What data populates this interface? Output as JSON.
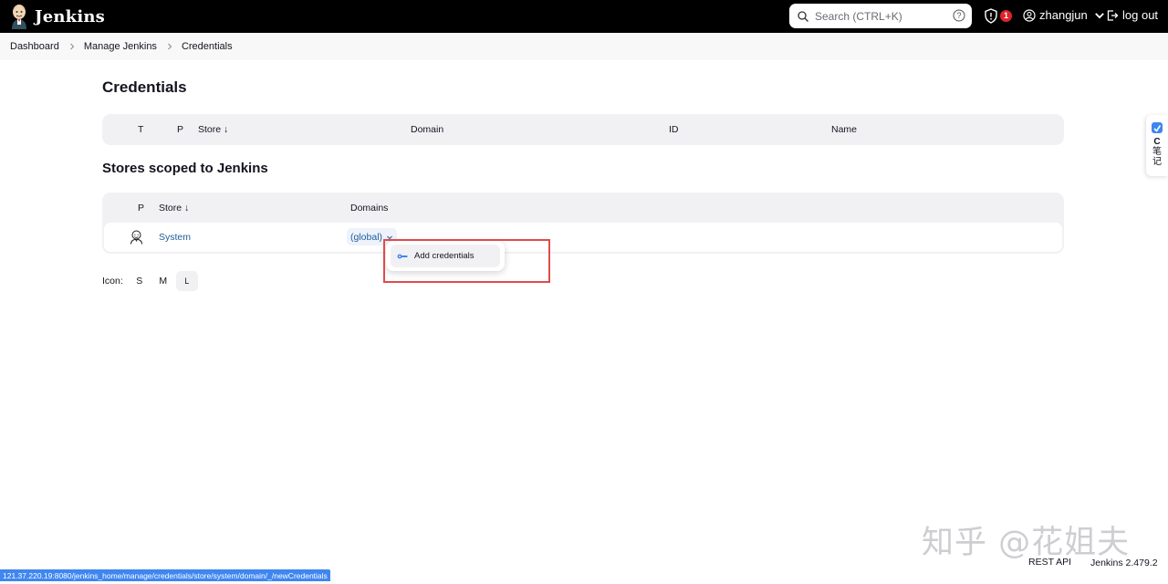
{
  "header": {
    "app_name": "Jenkins",
    "search_placeholder": "Search (CTRL+K)",
    "notification_count": "1",
    "username": "zhangjun",
    "logout_label": "log out"
  },
  "breadcrumb": {
    "items": [
      "Dashboard",
      "Manage Jenkins",
      "Credentials"
    ]
  },
  "credentials": {
    "title": "Credentials",
    "columns": [
      "T",
      "P",
      "Store ↓",
      "Domain",
      "ID",
      "Name"
    ]
  },
  "stores": {
    "title": "Stores scoped to Jenkins",
    "columns": [
      "P",
      "Store ↓",
      "Domains"
    ],
    "rows": [
      {
        "store": "System",
        "domain": "(global)"
      }
    ]
  },
  "dropdown": {
    "item_label": "Add credentials"
  },
  "icon_size": {
    "label": "Icon:",
    "options": [
      "S",
      "M",
      "L"
    ],
    "selected": "L"
  },
  "side_widget": {
    "label_line1": "C",
    "label_line2": "笔",
    "label_line3": "记"
  },
  "footer": {
    "rest_api": "REST API",
    "version": "Jenkins 2.479.2"
  },
  "status_bar": {
    "url": "121.37.220.19:8080/jenkins_home/manage/credentials/store/system/domain/_/newCredentials"
  },
  "watermark": {
    "text": "知乎 @花姐夫"
  },
  "colors": {
    "header_bg": "#000000",
    "link": "#1c5d9c",
    "badge": "#e0232e",
    "highlight_box": "#e04b4b",
    "table_bg": "#f1f1f4"
  }
}
